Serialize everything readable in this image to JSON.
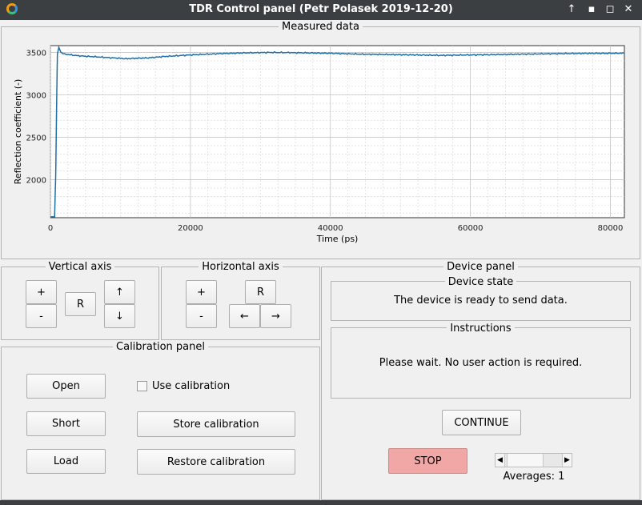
{
  "window": {
    "title": "TDR Control panel (Petr Polasek 2019-12-20)"
  },
  "measured": {
    "title": "Measured data",
    "chart_data": {
      "type": "line",
      "title": "",
      "xlabel": "Time (ps)",
      "ylabel": "Reflection coefficient (-)",
      "xlim": [
        0,
        82000
      ],
      "ylim": [
        1550,
        3580
      ],
      "xticks": [
        0,
        20000,
        40000,
        60000,
        80000
      ],
      "yticks": [
        2000,
        2500,
        3000,
        3500
      ],
      "grid": true,
      "color": "#1f6fa7",
      "series": [
        {
          "x": [
            0,
            600,
            750,
            900,
            1000,
            1200,
            1500,
            2000,
            4000,
            6000,
            8000,
            10000,
            11000,
            12000,
            14000,
            16000,
            20000,
            24000,
            28000,
            32000,
            36000,
            40000,
            44000,
            48000,
            52000,
            56000,
            60000,
            64000,
            68000,
            72000,
            76000,
            80000,
            82000
          ],
          "y": [
            1560,
            1560,
            2050,
            3000,
            3480,
            3560,
            3500,
            3480,
            3460,
            3450,
            3440,
            3430,
            3425,
            3430,
            3435,
            3450,
            3470,
            3485,
            3495,
            3500,
            3495,
            3490,
            3480,
            3475,
            3470,
            3465,
            3470,
            3475,
            3480,
            3485,
            3488,
            3490,
            3490
          ]
        }
      ]
    }
  },
  "vertical": {
    "title": "Vertical axis",
    "plus": "+",
    "minus": "-",
    "reset": "R",
    "up": "↑",
    "down": "↓"
  },
  "horizontal": {
    "title": "Horizontal axis",
    "plus": "+",
    "minus": "-",
    "reset": "R",
    "left": "←",
    "right": "→"
  },
  "calibration": {
    "title": "Calibration panel",
    "open": "Open",
    "short": "Short",
    "load": "Load",
    "use_calibration": "Use calibration",
    "store": "Store calibration",
    "restore": "Restore calibration"
  },
  "device": {
    "title": "Device panel",
    "state_title": "Device state",
    "state_text": "The device is ready to send data.",
    "instr_title": "Instructions",
    "instr_text": "Please wait. No user action is required.",
    "continue": "CONTINUE",
    "stop": "STOP",
    "averages": "Averages: 1",
    "averages_level": 0.1
  }
}
